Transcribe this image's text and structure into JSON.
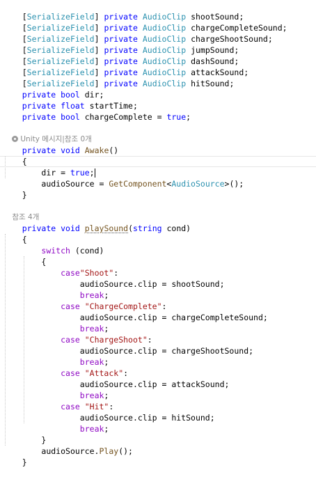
{
  "colors": {
    "keyword": "#0000ff",
    "type": "#2b91af",
    "attr_bracket": "#000000",
    "string": "#a31515",
    "method": "#74531f",
    "control": "#8f08c4",
    "hint": "#8a8a8a",
    "plain": "#000000"
  },
  "code": {
    "l1": [
      "[",
      "SerializeField",
      "] ",
      "private",
      " ",
      "AudioClip",
      " shootSound;"
    ],
    "l2": [
      "[",
      "SerializeField",
      "] ",
      "private",
      " ",
      "AudioClip",
      " chargeCompleteSound;"
    ],
    "l3": [
      "[",
      "SerializeField",
      "] ",
      "private",
      " ",
      "AudioClip",
      " chargeShootSound;"
    ],
    "l4": [
      "[",
      "SerializeField",
      "] ",
      "private",
      " ",
      "AudioClip",
      " jumpSound;"
    ],
    "l5": [
      "[",
      "SerializeField",
      "] ",
      "private",
      " ",
      "AudioClip",
      " dashSound;"
    ],
    "l6": [
      "[",
      "SerializeField",
      "] ",
      "private",
      " ",
      "AudioClip",
      " attackSound;"
    ],
    "l7": [
      "[",
      "SerializeField",
      "] ",
      "private",
      " ",
      "AudioClip",
      " hitSound;"
    ],
    "l8": [
      "private",
      " ",
      "bool",
      " dir;"
    ],
    "l9": [
      "private",
      " ",
      "float",
      " startTime;"
    ],
    "l10": [
      "private",
      " ",
      "bool",
      " chargeComplete = ",
      "true",
      ";"
    ],
    "hint1": "Unity 메시지|참조 0개",
    "l12": [
      "private",
      " ",
      "void",
      " ",
      "Awake",
      "()"
    ],
    "l13": "{",
    "l14": [
      "    dir = ",
      "true",
      ";"
    ],
    "l15": [
      "    audioSource = ",
      "GetComponent",
      "<",
      "AudioSource",
      ">();"
    ],
    "l16": "}",
    "hint2": "참조 4개",
    "l18": [
      "private",
      " ",
      "void",
      " ",
      "playSound",
      "(",
      "string",
      " cond)"
    ],
    "l19": "{",
    "l20": [
      "    ",
      "switch",
      " (cond)"
    ],
    "l21": "    {",
    "l22": [
      "        ",
      "case",
      "\"Shoot\"",
      ":"
    ],
    "l23": "            audioSource.clip = shootSound;",
    "l24": [
      "            ",
      "break",
      ";"
    ],
    "l25": [
      "        ",
      "case",
      " ",
      "\"ChargeComplete\"",
      ":"
    ],
    "l26": "            audioSource.clip = chargeCompleteSound;",
    "l27": [
      "            ",
      "break",
      ";"
    ],
    "l28": [
      "        ",
      "case",
      " ",
      "\"ChargeShoot\"",
      ":"
    ],
    "l29": "            audioSource.clip = chargeShootSound;",
    "l30": [
      "            ",
      "break",
      ";"
    ],
    "l31": [
      "        ",
      "case",
      " ",
      "\"Attack\"",
      ":"
    ],
    "l32": "            audioSource.clip = attackSound;",
    "l33": [
      "            ",
      "break",
      ";"
    ],
    "l34": [
      "        ",
      "case",
      " ",
      "\"Hit\"",
      ":"
    ],
    "l35": "            audioSource.clip = hitSound;",
    "l36": [
      "            ",
      "break",
      ";"
    ],
    "l37": "    }",
    "l38": [
      "    audioSource.",
      "Play",
      "();"
    ],
    "l39": "}"
  }
}
